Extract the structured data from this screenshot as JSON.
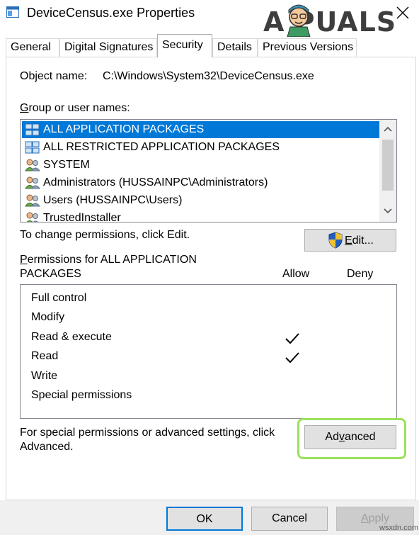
{
  "window": {
    "title": "DeviceCensus.exe Properties",
    "close_glyph": "✕",
    "icon": "app-window-icon"
  },
  "watermark": {
    "text": "A  PUALS",
    "mascot_icon": "appuals-mascot-icon",
    "site": "wsxdn.com"
  },
  "tabs": [
    {
      "label": "General",
      "active": false
    },
    {
      "label": "Digital Signatures",
      "active": false
    },
    {
      "label": "Security",
      "active": true
    },
    {
      "label": "Details",
      "active": false
    },
    {
      "label": "Previous Versions",
      "active": false
    }
  ],
  "object": {
    "label": "Object name:",
    "value": "C:\\Windows\\System32\\DeviceCensus.exe"
  },
  "groups": {
    "label": "Group or user names:",
    "label_mnemonic": "G",
    "items": [
      {
        "name": "ALL APPLICATION PACKAGES",
        "icon": "app-packages-icon",
        "selected": true
      },
      {
        "name": "ALL RESTRICTED APPLICATION PACKAGES",
        "icon": "app-packages-icon",
        "selected": false
      },
      {
        "name": "SYSTEM",
        "icon": "users-group-icon",
        "selected": false
      },
      {
        "name": "Administrators (HUSSAINPC\\Administrators)",
        "icon": "users-group-icon",
        "selected": false
      },
      {
        "name": "Users (HUSSAINPC\\Users)",
        "icon": "users-group-icon",
        "selected": false
      },
      {
        "name": "TrustedInstaller",
        "icon": "users-group-icon",
        "selected": false
      }
    ]
  },
  "change_hint": "To change permissions, click Edit.",
  "edit_button": {
    "label": "Edit...",
    "mnemonic": "E",
    "icon": "uac-shield-icon"
  },
  "permissions": {
    "header_line1": "Permissions for ALL APPLICATION",
    "header_line2": "PACKAGES",
    "header_mnemonic": "P",
    "allow_label": "Allow",
    "deny_label": "Deny",
    "rows": [
      {
        "name": "Full control",
        "allow": false,
        "deny": false
      },
      {
        "name": "Modify",
        "allow": false,
        "deny": false
      },
      {
        "name": "Read & execute",
        "allow": true,
        "deny": false
      },
      {
        "name": "Read",
        "allow": true,
        "deny": false
      },
      {
        "name": "Write",
        "allow": false,
        "deny": false
      },
      {
        "name": "Special permissions",
        "allow": false,
        "deny": false
      }
    ]
  },
  "advanced": {
    "hint_line1": "For special permissions or advanced settings, click",
    "hint_line2": "Advanced.",
    "button_label": "Advanced",
    "mnemonic": "v",
    "highlight_color": "#9be25a"
  },
  "footer": {
    "ok": "OK",
    "cancel": "Cancel",
    "apply": "Apply",
    "apply_mnemonic": "A",
    "apply_enabled": false
  },
  "colors": {
    "selection": "#0078d7",
    "focus_border": "#0078d7",
    "button_face": "#e1e1e1",
    "disabled_text": "#a0a0a0"
  }
}
